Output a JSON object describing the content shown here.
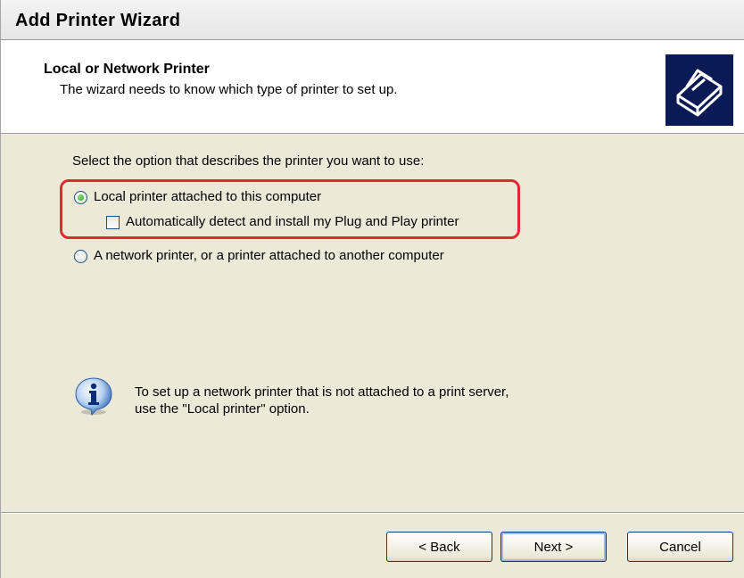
{
  "window": {
    "title": "Add Printer Wizard"
  },
  "header": {
    "title": "Local or Network Printer",
    "subtitle": "The wizard needs to know which type of printer to set up.",
    "icon": "printer-icon"
  },
  "content": {
    "prompt": "Select the option that describes the printer you want to use:",
    "options": [
      {
        "label": "Local printer attached to this computer",
        "selected": true
      },
      {
        "label": "A network printer, or a printer attached to another computer",
        "selected": false
      }
    ],
    "auto_detect": {
      "label": "Automatically detect and install my Plug and Play printer",
      "checked": false
    },
    "info": {
      "icon": "info-icon",
      "line1": "To set up a network printer that is not attached to a print server,",
      "line2": "use the \"Local printer\" option."
    },
    "highlight_color": "#e02a33"
  },
  "buttons": {
    "back": "< Back",
    "next": "Next >",
    "cancel": "Cancel"
  }
}
